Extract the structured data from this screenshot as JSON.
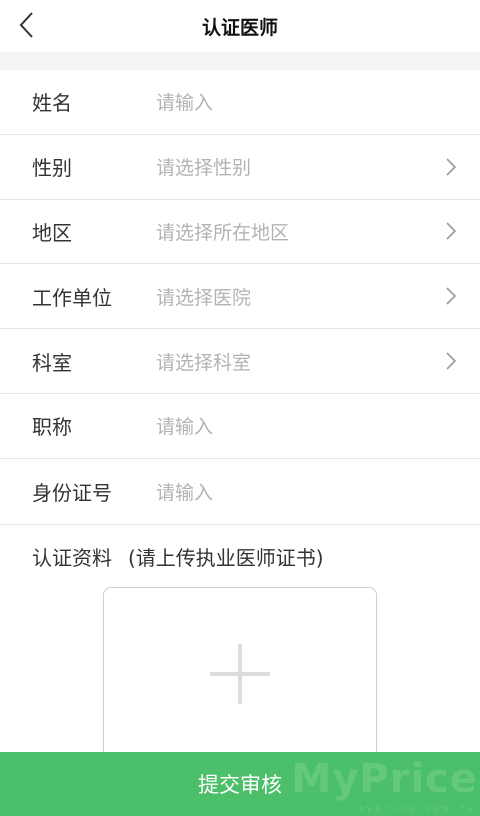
{
  "header": {
    "title": "认证医师",
    "back_icon": "chevron-left-icon"
  },
  "form": {
    "rows": [
      {
        "label": "姓名",
        "placeholder": "请输入",
        "has_arrow": false
      },
      {
        "label": "性别",
        "placeholder": "请选择性别",
        "has_arrow": true
      },
      {
        "label": "地区",
        "placeholder": "请选择所在地区",
        "has_arrow": true
      },
      {
        "label": "工作单位",
        "placeholder": "请选择医院",
        "has_arrow": true
      },
      {
        "label": "科室",
        "placeholder": "请选择科室",
        "has_arrow": true
      },
      {
        "label": "职称",
        "placeholder": "请输入",
        "has_arrow": false
      },
      {
        "label": "身份证号",
        "placeholder": "请输入",
        "has_arrow": false
      }
    ],
    "certification": {
      "label": "认证资料",
      "hint": "(请上传执业医师证书)",
      "upload_icon": "plus-icon"
    }
  },
  "submit": {
    "label": "提交审核"
  },
  "watermark": {
    "text": "MyPrice",
    "sub": "myprice.com.tw"
  },
  "colors": {
    "accent": "#4cbf6b",
    "placeholder": "#b3b3b3",
    "divider": "#e6e6e6",
    "section_gap": "#f4f4f4"
  }
}
